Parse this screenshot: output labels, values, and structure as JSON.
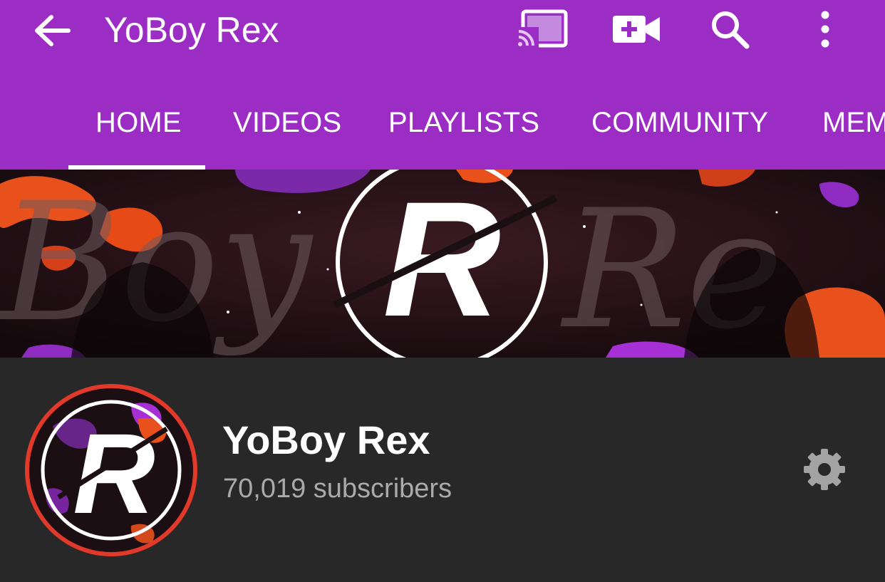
{
  "app_bar": {
    "title": "YoBoy Rex",
    "background_color": "#9b2cc4",
    "icons": {
      "back": "arrow-back-icon",
      "cast": "cast-icon",
      "create": "video-add-icon",
      "search": "search-icon",
      "more": "more-vert-icon"
    }
  },
  "tabs": [
    {
      "label": "HOME",
      "selected": true
    },
    {
      "label": "VIDEOS",
      "selected": false
    },
    {
      "label": "PLAYLISTS",
      "selected": false
    },
    {
      "label": "COMMUNITY",
      "selected": false
    },
    {
      "label": "MEM",
      "selected": false
    }
  ],
  "banner": {
    "logo_letter": "R",
    "accent_colors": [
      "#e8501c",
      "#a62fd6",
      "#1a0f12"
    ]
  },
  "channel": {
    "name": "YoBoy Rex",
    "subscribers": "70,019 subscribers",
    "avatar_letter": "R",
    "avatar_ring_color": "#e23a2a",
    "settings_icon": "gear-icon"
  }
}
